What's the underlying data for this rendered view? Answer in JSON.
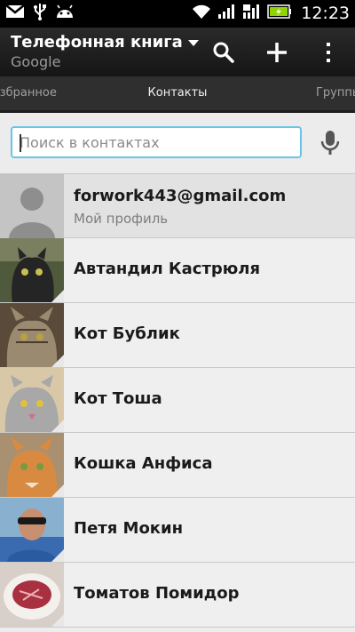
{
  "status_bar": {
    "time": "12:23",
    "icons": [
      "gmail-icon",
      "usb-icon",
      "android-icon",
      "wifi-icon",
      "signal-icon",
      "signal-icon",
      "battery-charging-icon"
    ]
  },
  "app_bar": {
    "title": "Телефонная книга",
    "subtitle": "Google",
    "actions": [
      "search-icon",
      "add-icon",
      "overflow-menu-icon"
    ]
  },
  "tabs": [
    {
      "label": "Избранное"
    },
    {
      "label": "Контакты",
      "selected": true
    },
    {
      "label": "Группы"
    }
  ],
  "search": {
    "placeholder": "Поиск в контактах",
    "value": ""
  },
  "profile": {
    "email": "forwork443@gmail.com",
    "subtitle": "Мой профиль"
  },
  "contacts": [
    {
      "name": "Автандил Кастрюля"
    },
    {
      "name": "Кот Бублик"
    },
    {
      "name": "Кот Тоша"
    },
    {
      "name": "Кошка Анфиса"
    },
    {
      "name": "Петя Мокин"
    },
    {
      "name": "Томатов Помидор"
    }
  ],
  "colors": {
    "accent": "#67c6e6",
    "app_bar": "#1c1c1c",
    "battery": "#8fd400"
  }
}
